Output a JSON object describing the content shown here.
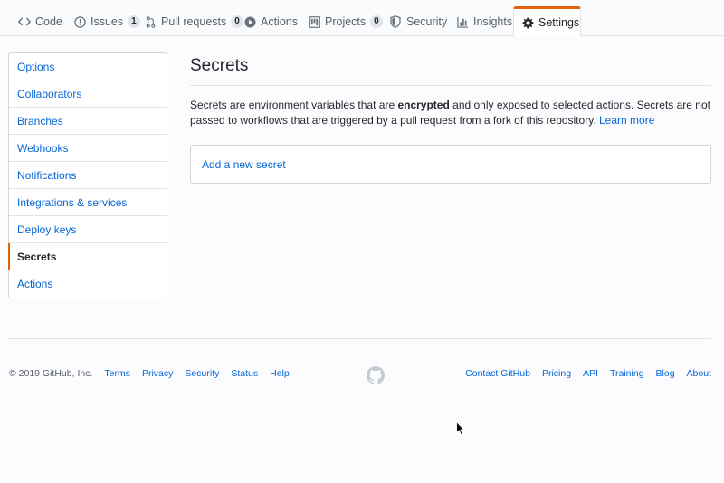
{
  "tabs": [
    {
      "label": "Code",
      "icon": "code-icon"
    },
    {
      "label": "Issues",
      "icon": "issue-icon",
      "count": "1"
    },
    {
      "label": "Pull requests",
      "icon": "pull-request-icon",
      "count": "0"
    },
    {
      "label": "Actions",
      "icon": "play-icon"
    },
    {
      "label": "Projects",
      "icon": "project-icon",
      "count": "0"
    },
    {
      "label": "Security",
      "icon": "shield-icon"
    },
    {
      "label": "Insights",
      "icon": "graph-icon"
    },
    {
      "label": "Settings",
      "icon": "gear-icon",
      "active": true
    }
  ],
  "sidebar": {
    "items": [
      {
        "label": "Options"
      },
      {
        "label": "Collaborators"
      },
      {
        "label": "Branches"
      },
      {
        "label": "Webhooks"
      },
      {
        "label": "Notifications"
      },
      {
        "label": "Integrations & services"
      },
      {
        "label": "Deploy keys"
      },
      {
        "label": "Secrets",
        "selected": true
      },
      {
        "label": "Actions"
      }
    ]
  },
  "main": {
    "title": "Secrets",
    "description_part1": "Secrets are environment variables that are ",
    "description_bold": "encrypted",
    "description_part2": " and only exposed to selected actions. Secrets are not passed to workflows that are triggered by a pull request from a fork of this repository. ",
    "learn_more": "Learn more",
    "add_secret": "Add a new secret"
  },
  "footer": {
    "copyright": "© 2019 GitHub, Inc.",
    "left_links": [
      "Terms",
      "Privacy",
      "Security",
      "Status",
      "Help"
    ],
    "right_links": [
      "Contact GitHub",
      "Pricing",
      "API",
      "Training",
      "Blog",
      "About"
    ],
    "logo": "github-mark-icon"
  },
  "colors": {
    "accent": "#e36209",
    "link": "#0366d6",
    "text": "#24292e",
    "muted": "#586069",
    "border": "#e1e4e8"
  }
}
